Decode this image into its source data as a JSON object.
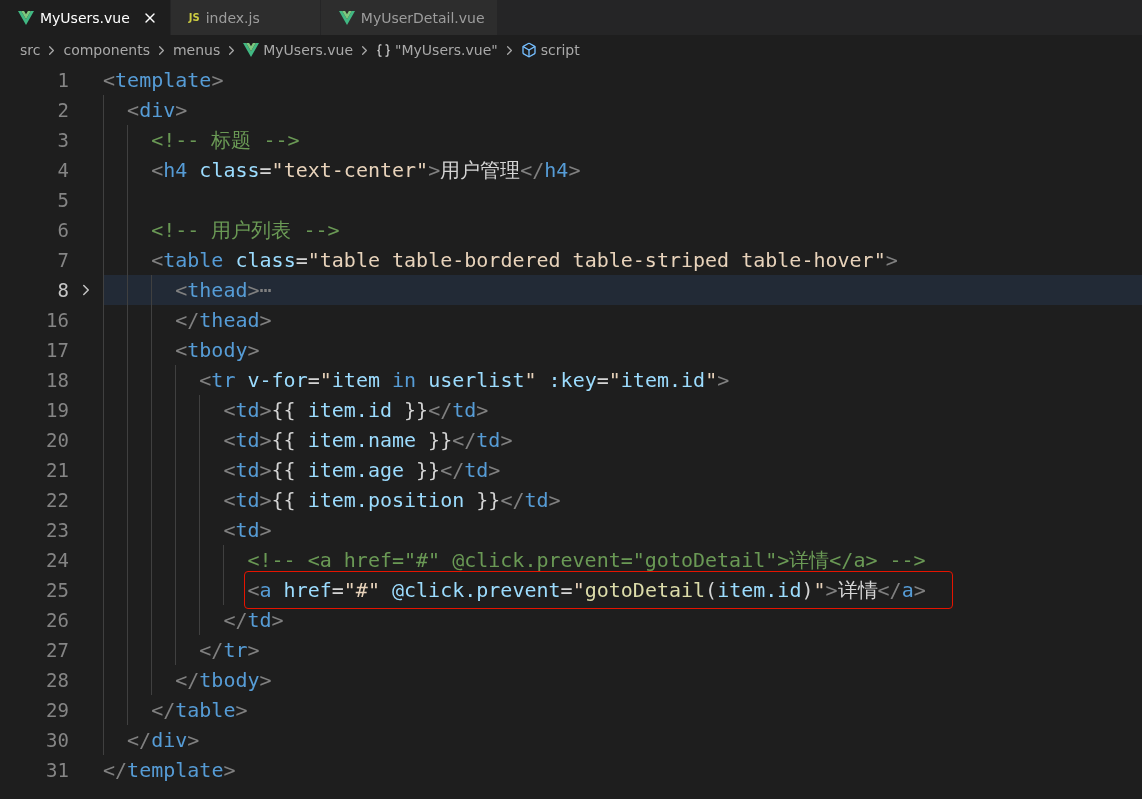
{
  "tabs": [
    {
      "label": "MyUsers.vue",
      "kind": "vue",
      "selected": true
    },
    {
      "label": "index.js",
      "kind": "js",
      "icon_text": "JS",
      "selected": false
    },
    {
      "label": "MyUserDetail.vue",
      "kind": "vue",
      "selected": false
    }
  ],
  "breadcrumb": [
    {
      "label": "src",
      "kind": "folder"
    },
    {
      "label": "components",
      "kind": "folder"
    },
    {
      "label": "menus",
      "kind": "folder"
    },
    {
      "label": "MyUsers.vue",
      "kind": "vue"
    },
    {
      "label": "\"MyUsers.vue\"",
      "kind": "braces"
    },
    {
      "label": "script",
      "kind": "cube"
    }
  ],
  "lines": [
    {
      "n": "1",
      "code": [
        {
          "text": "<",
          "kind": "punct"
        },
        {
          "text": "template",
          "kind": "tag"
        },
        {
          "text": ">",
          "kind": "punct"
        }
      ],
      "children": [
        {
          "n": "2",
          "code": [
            {
              "text": "<",
              "kind": "punct"
            },
            {
              "text": "div",
              "kind": "tag"
            },
            {
              "text": ">",
              "kind": "punct"
            }
          ],
          "children": [
            {
              "n": "3",
              "code": [
                {
                  "text": "<!-- 标题 -->",
                  "kind": "comment"
                }
              ]
            },
            {
              "n": "4",
              "code": [
                {
                  "text": "<",
                  "kind": "punct"
                },
                {
                  "text": "h4",
                  "kind": "tag"
                },
                {
                  "text": " class",
                  "kind": "attr"
                },
                {
                  "text": "=",
                  "kind": "text"
                },
                {
                  "text": "\"text-center\"",
                  "kind": "string"
                },
                {
                  "text": ">",
                  "kind": "punct"
                },
                {
                  "text": "用户管理",
                  "kind": "text"
                },
                {
                  "text": "</",
                  "kind": "punct"
                },
                {
                  "text": "h4",
                  "kind": "tag"
                },
                {
                  "text": ">",
                  "kind": "punct"
                }
              ]
            },
            {
              "n": "5"
            },
            {
              "n": "6",
              "code": [
                {
                  "text": "<!-- 用户列表 -->",
                  "kind": "comment"
                }
              ]
            },
            {
              "n": "7",
              "code": [
                {
                  "text": "<",
                  "kind": "punct"
                },
                {
                  "text": "table",
                  "kind": "tag"
                },
                {
                  "text": " class",
                  "kind": "attr"
                },
                {
                  "text": "=",
                  "kind": "text"
                },
                {
                  "text": "\"table table-bordered table-striped table-hover\"",
                  "kind": "string"
                },
                {
                  "text": ">",
                  "kind": "punct"
                }
              ],
              "children": [
                {
                  "n": "8",
                  "current": true,
                  "folded": true,
                  "code": [
                    {
                      "text": "<",
                      "kind": "punct"
                    },
                    {
                      "text": "thead",
                      "kind": "tag"
                    },
                    {
                      "text": ">⋯",
                      "kind": "punct"
                    }
                  ]
                },
                {
                  "n": "16",
                  "code": [
                    {
                      "text": "</",
                      "kind": "punct"
                    },
                    {
                      "text": "thead",
                      "kind": "tag"
                    },
                    {
                      "text": ">",
                      "kind": "punct"
                    }
                  ]
                },
                {
                  "n": "17",
                  "code": [
                    {
                      "text": "<",
                      "kind": "punct"
                    },
                    {
                      "text": "tbody",
                      "kind": "tag"
                    },
                    {
                      "text": ">",
                      "kind": "punct"
                    }
                  ],
                  "children": [
                    {
                      "n": "18",
                      "code": [
                        {
                          "text": "<",
                          "kind": "punct"
                        },
                        {
                          "text": "tr",
                          "kind": "tag"
                        },
                        {
                          "text": " v-for",
                          "kind": "attr"
                        },
                        {
                          "text": "=",
                          "kind": "text"
                        },
                        {
                          "text": "\"",
                          "kind": "string"
                        },
                        {
                          "text": "item",
                          "kind": "variable"
                        },
                        {
                          "text": " in ",
                          "kind": "keyword"
                        },
                        {
                          "text": "userlist",
                          "kind": "variable"
                        },
                        {
                          "text": "\" ",
                          "kind": "string"
                        },
                        {
                          "text": ":key",
                          "kind": "attr"
                        },
                        {
                          "text": "=",
                          "kind": "text"
                        },
                        {
                          "text": "\"",
                          "kind": "string"
                        },
                        {
                          "text": "item.id",
                          "kind": "variable"
                        },
                        {
                          "text": "\"",
                          "kind": "string"
                        },
                        {
                          "text": ">",
                          "kind": "punct"
                        }
                      ],
                      "children": [
                        {
                          "n": "19",
                          "code": [
                            {
                              "text": "<",
                              "kind": "punct"
                            },
                            {
                              "text": "td",
                              "kind": "tag"
                            },
                            {
                              "text": ">",
                              "kind": "punct"
                            },
                            {
                              "text": "{{ ",
                              "kind": "text"
                            },
                            {
                              "text": "item.id",
                              "kind": "variable"
                            },
                            {
                              "text": " }}",
                              "kind": "text"
                            },
                            {
                              "text": "</",
                              "kind": "punct"
                            },
                            {
                              "text": "td",
                              "kind": "tag"
                            },
                            {
                              "text": ">",
                              "kind": "punct"
                            }
                          ]
                        },
                        {
                          "n": "20",
                          "code": [
                            {
                              "text": "<",
                              "kind": "punct"
                            },
                            {
                              "text": "td",
                              "kind": "tag"
                            },
                            {
                              "text": ">",
                              "kind": "punct"
                            },
                            {
                              "text": "{{ ",
                              "kind": "text"
                            },
                            {
                              "text": "item.name",
                              "kind": "variable"
                            },
                            {
                              "text": " }}",
                              "kind": "text"
                            },
                            {
                              "text": "</",
                              "kind": "punct"
                            },
                            {
                              "text": "td",
                              "kind": "tag"
                            },
                            {
                              "text": ">",
                              "kind": "punct"
                            }
                          ]
                        },
                        {
                          "n": "21",
                          "code": [
                            {
                              "text": "<",
                              "kind": "punct"
                            },
                            {
                              "text": "td",
                              "kind": "tag"
                            },
                            {
                              "text": ">",
                              "kind": "punct"
                            },
                            {
                              "text": "{{ ",
                              "kind": "text"
                            },
                            {
                              "text": "item.age",
                              "kind": "variable"
                            },
                            {
                              "text": " }}",
                              "kind": "text"
                            },
                            {
                              "text": "</",
                              "kind": "punct"
                            },
                            {
                              "text": "td",
                              "kind": "tag"
                            },
                            {
                              "text": ">",
                              "kind": "punct"
                            }
                          ]
                        },
                        {
                          "n": "22",
                          "code": [
                            {
                              "text": "<",
                              "kind": "punct"
                            },
                            {
                              "text": "td",
                              "kind": "tag"
                            },
                            {
                              "text": ">",
                              "kind": "punct"
                            },
                            {
                              "text": "{{ ",
                              "kind": "text"
                            },
                            {
                              "text": "item.position",
                              "kind": "variable"
                            },
                            {
                              "text": " }}",
                              "kind": "text"
                            },
                            {
                              "text": "</",
                              "kind": "punct"
                            },
                            {
                              "text": "td",
                              "kind": "tag"
                            },
                            {
                              "text": ">",
                              "kind": "punct"
                            }
                          ]
                        },
                        {
                          "n": "23",
                          "code": [
                            {
                              "text": "<",
                              "kind": "punct"
                            },
                            {
                              "text": "td",
                              "kind": "tag"
                            },
                            {
                              "text": ">",
                              "kind": "punct"
                            }
                          ],
                          "children": [
                            {
                              "n": "24",
                              "code": [
                                {
                                  "text": "<!-- <a href=\"#\" @click.prevent=\"gotoDetail\">详情</a> -->",
                                  "kind": "comment"
                                }
                              ]
                            },
                            {
                              "n": "25",
                              "boxed": true,
                              "code": [
                                {
                                  "text": "<",
                                  "kind": "punct"
                                },
                                {
                                  "text": "a",
                                  "kind": "tag"
                                },
                                {
                                  "text": " href",
                                  "kind": "attr"
                                },
                                {
                                  "text": "=",
                                  "kind": "text"
                                },
                                {
                                  "text": "\"#\" ",
                                  "kind": "string"
                                },
                                {
                                  "text": "@click.prevent",
                                  "kind": "attr"
                                },
                                {
                                  "text": "=",
                                  "kind": "text"
                                },
                                {
                                  "text": "\"",
                                  "kind": "string"
                                },
                                {
                                  "text": "gotoDetail",
                                  "kind": "function"
                                },
                                {
                                  "text": "(",
                                  "kind": "text"
                                },
                                {
                                  "text": "item.id",
                                  "kind": "variable"
                                },
                                {
                                  "text": ")",
                                  "kind": "text"
                                },
                                {
                                  "text": "\"",
                                  "kind": "string"
                                },
                                {
                                  "text": ">",
                                  "kind": "punct"
                                },
                                {
                                  "text": "详情",
                                  "kind": "text"
                                },
                                {
                                  "text": "</",
                                  "kind": "punct"
                                },
                                {
                                  "text": "a",
                                  "kind": "tag"
                                },
                                {
                                  "text": ">",
                                  "kind": "punct"
                                }
                              ]
                            }
                          ]
                        },
                        {
                          "n": "26",
                          "code": [
                            {
                              "text": "</",
                              "kind": "punct"
                            },
                            {
                              "text": "td",
                              "kind": "tag"
                            },
                            {
                              "text": ">",
                              "kind": "punct"
                            }
                          ]
                        }
                      ]
                    },
                    {
                      "n": "27",
                      "code": [
                        {
                          "text": "</",
                          "kind": "punct"
                        },
                        {
                          "text": "tr",
                          "kind": "tag"
                        },
                        {
                          "text": ">",
                          "kind": "punct"
                        }
                      ]
                    }
                  ]
                },
                {
                  "n": "28",
                  "code": [
                    {
                      "text": "</",
                      "kind": "punct"
                    },
                    {
                      "text": "tbody",
                      "kind": "tag"
                    },
                    {
                      "text": ">",
                      "kind": "punct"
                    }
                  ]
                }
              ]
            },
            {
              "n": "29",
              "code": [
                {
                  "text": "</",
                  "kind": "punct"
                },
                {
                  "text": "table",
                  "kind": "tag"
                },
                {
                  "text": ">",
                  "kind": "punct"
                }
              ]
            }
          ]
        },
        {
          "n": "30",
          "code": [
            {
              "text": "</",
              "kind": "punct"
            },
            {
              "text": "div",
              "kind": "tag"
            },
            {
              "text": ">",
              "kind": "punct"
            }
          ]
        }
      ]
    },
    {
      "n": "31",
      "code": [
        {
          "text": "</",
          "kind": "punct"
        },
        {
          "text": "template",
          "kind": "tag"
        },
        {
          "text": ">",
          "kind": "punct"
        }
      ]
    }
  ]
}
